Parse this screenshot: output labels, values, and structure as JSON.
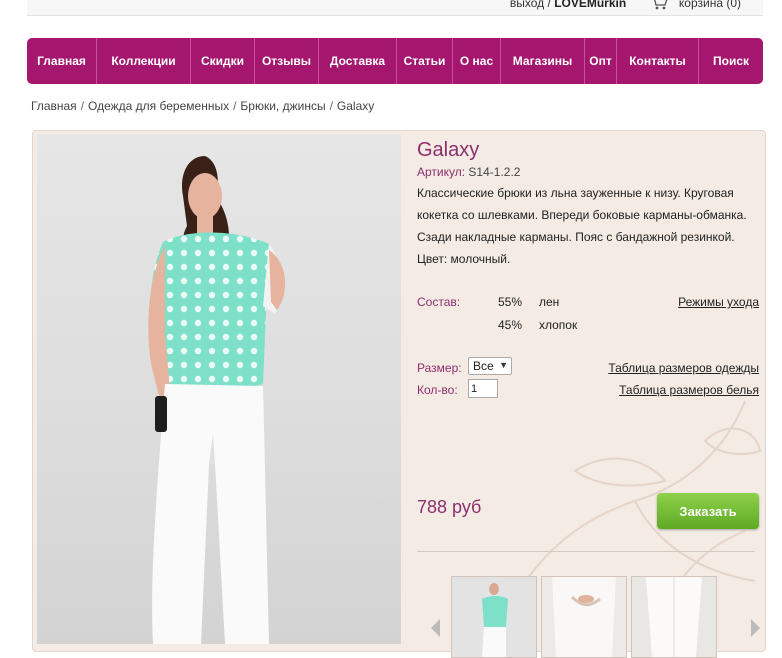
{
  "topbar": {
    "logout": "выход",
    "separator": "/",
    "username": "LOVEMurkin",
    "cart": "корзина (0)"
  },
  "nav": [
    "Главная",
    "Коллекции",
    "Скидки",
    "Отзывы",
    "Доставка",
    "Статьи",
    "О нас",
    "Магазины",
    "Опт",
    "Контакты",
    "Поиск"
  ],
  "breadcrumb": [
    "Главная",
    "Одежда для беременных",
    "Брюки, джинсы",
    "Galaxy"
  ],
  "product": {
    "title": "Galaxy",
    "sku_label": "Артикул:",
    "sku": "S14-1.2.2",
    "description": "Классические брюки из льна зауженные к низу. Круговая кокетка со шлевками. Впереди боковые карманы-обманка. Сзади накладные карманы. Пояс с бандажной резинкой. Цвет: молочный.",
    "composition_label": "Состав:",
    "composition": [
      {
        "percent": "55%",
        "material": "лен"
      },
      {
        "percent": "45%",
        "material": "хлопок"
      }
    ],
    "care_link": "Режимы ухода",
    "size_label": "Размер:",
    "size_value": "Все",
    "size_table_link": "Таблица размеров одежды",
    "qty_label": "Кол-во:",
    "qty_value": "1",
    "lingerie_table_link": "Таблица размеров белья",
    "price": "788 руб",
    "order_button": "Заказать"
  },
  "colors": {
    "nav": "#a5166f",
    "accent": "#8f2f6f",
    "button": "#6fb631",
    "panel": "#f3ebe4"
  }
}
